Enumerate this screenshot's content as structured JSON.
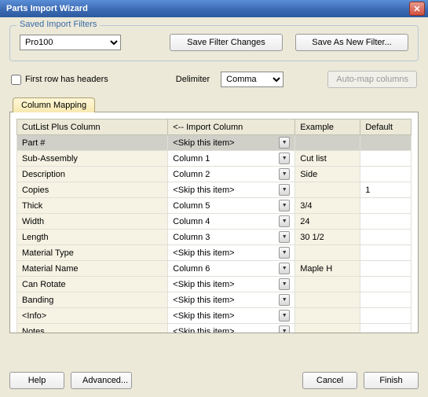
{
  "window": {
    "title": "Parts Import Wizard"
  },
  "filters": {
    "legend": "Saved Import Filters",
    "selected": "Pro100",
    "save_changes_label": "Save Filter Changes",
    "save_new_label": "Save As New Filter..."
  },
  "options": {
    "first_row_label": "First row has headers",
    "first_row_checked": false,
    "delimiter_label": "Delimiter",
    "delimiter_value": "Comma",
    "automap_label": "Auto-map columns"
  },
  "tab": {
    "label": "Column Mapping"
  },
  "grid": {
    "headers": {
      "col1": "CutList Plus Column",
      "col2": "<-- Import Column",
      "col3": "Example",
      "col4": "Default"
    },
    "rows": [
      {
        "name": "Part #",
        "import": "<Skip this item>",
        "example": "",
        "default": "",
        "selected": true
      },
      {
        "name": "Sub-Assembly",
        "import": "Column 1",
        "example": "Cut list",
        "default": ""
      },
      {
        "name": "Description",
        "import": "Column 2",
        "example": "Side",
        "default": ""
      },
      {
        "name": "Copies",
        "import": "<Skip this item>",
        "example": "",
        "default": "1"
      },
      {
        "name": "Thick",
        "import": "Column 5",
        "example": "3/4",
        "default": ""
      },
      {
        "name": "Width",
        "import": "Column 4",
        "example": "24",
        "default": ""
      },
      {
        "name": "Length",
        "import": "Column 3",
        "example": "30 1/2",
        "default": ""
      },
      {
        "name": "Material Type",
        "import": "<Skip this item>",
        "example": "",
        "default": ""
      },
      {
        "name": "Material Name",
        "import": "Column 6",
        "example": "Maple H",
        "default": ""
      },
      {
        "name": "Can Rotate",
        "import": "<Skip this item>",
        "example": "",
        "default": ""
      },
      {
        "name": "Banding",
        "import": "<Skip this item>",
        "example": "",
        "default": ""
      },
      {
        "name": "<Info>",
        "import": "<Skip this item>",
        "example": "",
        "default": ""
      },
      {
        "name": "Notes",
        "import": "<Skip this item>",
        "example": "",
        "default": ""
      }
    ]
  },
  "footer": {
    "help": "Help",
    "advanced": "Advanced...",
    "cancel": "Cancel",
    "finish": "Finish"
  }
}
